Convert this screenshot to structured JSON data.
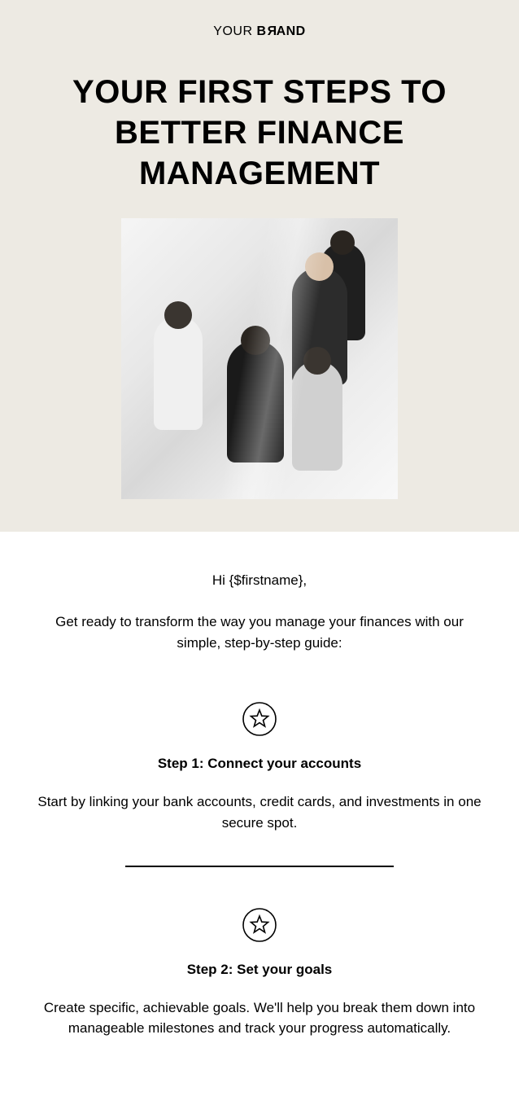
{
  "brand": {
    "part1": "YOUR ",
    "part2": "B",
    "flip": "R",
    "part3": "AND"
  },
  "headline": "YOUR FIRST STEPS TO BETTER FINANCE MANAGEMENT",
  "greeting": "Hi {$firstname},",
  "intro": "Get ready to transform the way you manage your finances with our simple, step-by-step guide:",
  "steps": [
    {
      "title": "Step 1: Connect your accounts",
      "body": "Start by linking your bank accounts, credit cards, and investments in one secure spot."
    },
    {
      "title": "Step 2: Set your goals",
      "body": "Create specific, achievable goals. We'll help you break them down into manageable milestones and track your progress automatically."
    }
  ]
}
